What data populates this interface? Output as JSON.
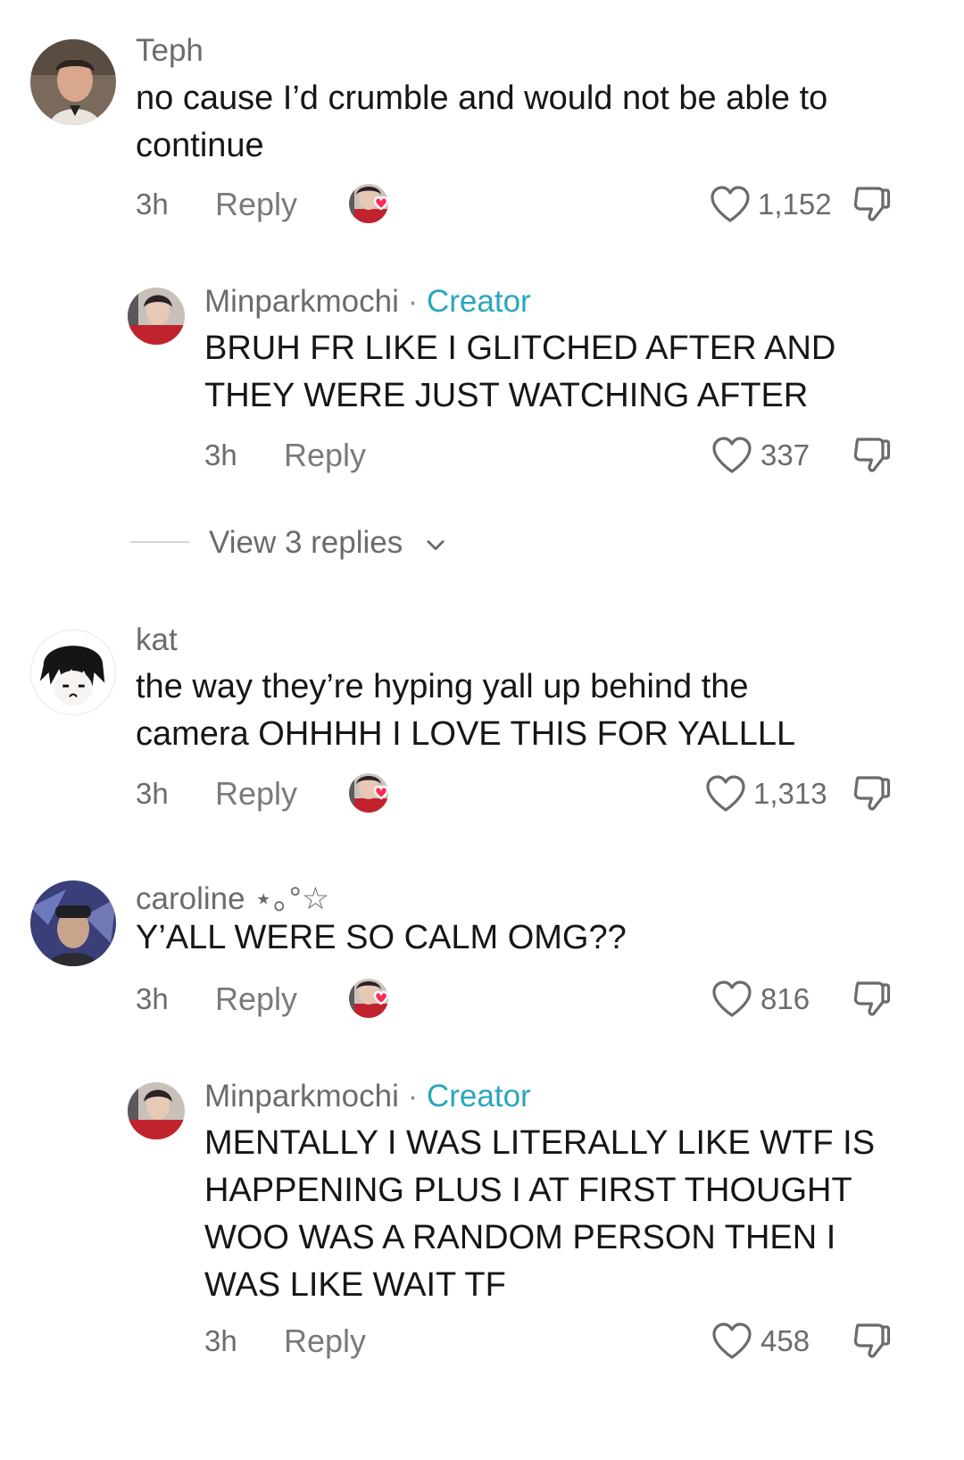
{
  "comments": [
    {
      "username": "Teph",
      "text": "no cause I’d crumble and would not be able to continue",
      "time": "3h",
      "reply_label": "Reply",
      "likes": "1,152"
    },
    {
      "username": "Minparkmochi",
      "separator": "·",
      "badge": "Creator",
      "text": "BRUH FR LIKE I GLITCHED AFTER AND THEY WERE JUST WATCHING AFTER",
      "time": "3h",
      "reply_label": "Reply",
      "likes": "337"
    },
    {
      "view_replies": "View 3 replies"
    },
    {
      "username": "kat",
      "text": "the way they’re hyping yall up behind the camera OHHHH I LOVE THIS FOR YALLLL",
      "time": "3h",
      "reply_label": "Reply",
      "likes": "1,313"
    },
    {
      "username": "caroline ⋆｡°☆",
      "text": "Y’ALL WERE SO CALM OMG??",
      "time": "3h",
      "reply_label": "Reply",
      "likes": "816"
    },
    {
      "username": "Minparkmochi",
      "separator": "·",
      "badge": "Creator",
      "text": "MENTALLY I WAS LITERALLY LIKE WTF IS HAPPENING PLUS I AT FIRST THOUGHT WOO WAS A RANDOM PERSON THEN I WAS LIKE WAIT TF",
      "time": "3h",
      "reply_label": "Reply",
      "likes": "458"
    }
  ],
  "icons": {
    "like": "heart-outline-icon",
    "dislike": "thumbs-down-icon",
    "creator_liked": "creator-liked-avatar-icon",
    "expand": "chevron-down-icon"
  },
  "colors": {
    "creator_badge": "#2aa6bd",
    "creator_heart": "#fe2c55",
    "meta_gray": "#6b6b6b"
  }
}
